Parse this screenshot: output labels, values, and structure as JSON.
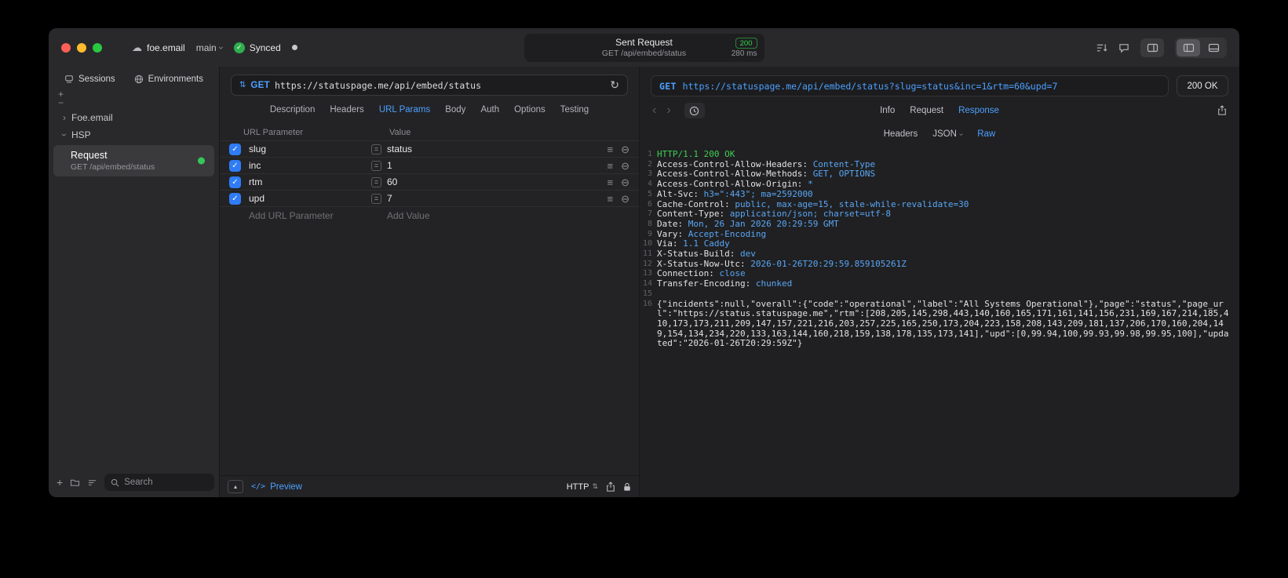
{
  "titlebar": {
    "project": "foe.email",
    "branch": "main",
    "sync": "Synced",
    "center": {
      "title": "Sent Request",
      "status_badge": "200",
      "subtitle": "GET /api/embed/status",
      "duration": "280 ms"
    }
  },
  "sidebar": {
    "tabs": [
      {
        "label": "Sessions"
      },
      {
        "label": "Environments"
      }
    ],
    "tree": [
      {
        "label": "Foe.email",
        "state": "collapsed"
      },
      {
        "label": "HSP",
        "state": "expanded"
      }
    ],
    "selected_request": {
      "title": "Request",
      "subtitle": "GET /api/embed/status"
    },
    "search_placeholder": "Search"
  },
  "request_panel": {
    "method": "GET",
    "url": "https://statuspage.me/api/embed/status",
    "tabs": [
      "Description",
      "Headers",
      "URL Params",
      "Body",
      "Auth",
      "Options",
      "Testing"
    ],
    "active_tab": "URL Params",
    "table": {
      "columns": [
        "URL Parameter",
        "Value"
      ],
      "rows": [
        {
          "name": "slug",
          "value": "status",
          "checked": true
        },
        {
          "name": "inc",
          "value": "1",
          "checked": true
        },
        {
          "name": "rtm",
          "value": "60",
          "checked": true
        },
        {
          "name": "upd",
          "value": "7",
          "checked": true
        }
      ],
      "add_param_placeholder": "Add URL Parameter",
      "add_value_placeholder": "Add Value"
    },
    "footer": {
      "preview": "Preview",
      "protocol": "HTTP"
    }
  },
  "response_panel": {
    "request_line": {
      "method": "GET",
      "url": "https://statuspage.me/api/embed/status?slug=status&inc=1&rtm=60&upd=7"
    },
    "status": "200 OK",
    "tabs": [
      "Info",
      "Request",
      "Response"
    ],
    "active_tab": "Response",
    "subtabs": [
      "Headers",
      "JSON",
      "Raw"
    ],
    "active_subtab": "Raw",
    "raw": {
      "status_line": "HTTP/1.1 200 OK",
      "headers": [
        {
          "name": "Access-Control-Allow-Headers",
          "value": "Content-Type"
        },
        {
          "name": "Access-Control-Allow-Methods",
          "value": "GET, OPTIONS"
        },
        {
          "name": "Access-Control-Allow-Origin",
          "value": "*"
        },
        {
          "name": "Alt-Svc",
          "value": "h3=\":443\"; ma=2592000"
        },
        {
          "name": "Cache-Control",
          "value": "public, max-age=15, stale-while-revalidate=30"
        },
        {
          "name": "Content-Type",
          "value": "application/json; charset=utf-8"
        },
        {
          "name": "Date",
          "value": "Mon, 26 Jan 2026 20:29:59 GMT"
        },
        {
          "name": "Vary",
          "value": "Accept-Encoding"
        },
        {
          "name": "Via",
          "value": "1.1 Caddy"
        },
        {
          "name": "X-Status-Build",
          "value": "dev"
        },
        {
          "name": "X-Status-Now-Utc",
          "value": "2026-01-26T20:29:59.859105261Z"
        },
        {
          "name": "Connection",
          "value": "close"
        },
        {
          "name": "Transfer-Encoding",
          "value": "chunked"
        }
      ],
      "body": "{\"incidents\":null,\"overall\":{\"code\":\"operational\",\"label\":\"All Systems Operational\"},\"page\":\"status\",\"page_url\":\"https://status.statuspage.me\",\"rtm\":[208,205,145,298,443,140,160,165,171,161,141,156,231,169,167,214,185,410,173,173,211,209,147,157,221,216,203,257,225,165,250,173,204,223,158,208,143,209,181,137,206,170,160,204,149,154,134,234,220,133,163,144,160,218,159,138,178,135,173,141],\"upd\":[0,99.94,100,99.93,99.98,99.95,100],\"updated\":\"2026-01-26T20:29:59Z\"}"
    }
  }
}
